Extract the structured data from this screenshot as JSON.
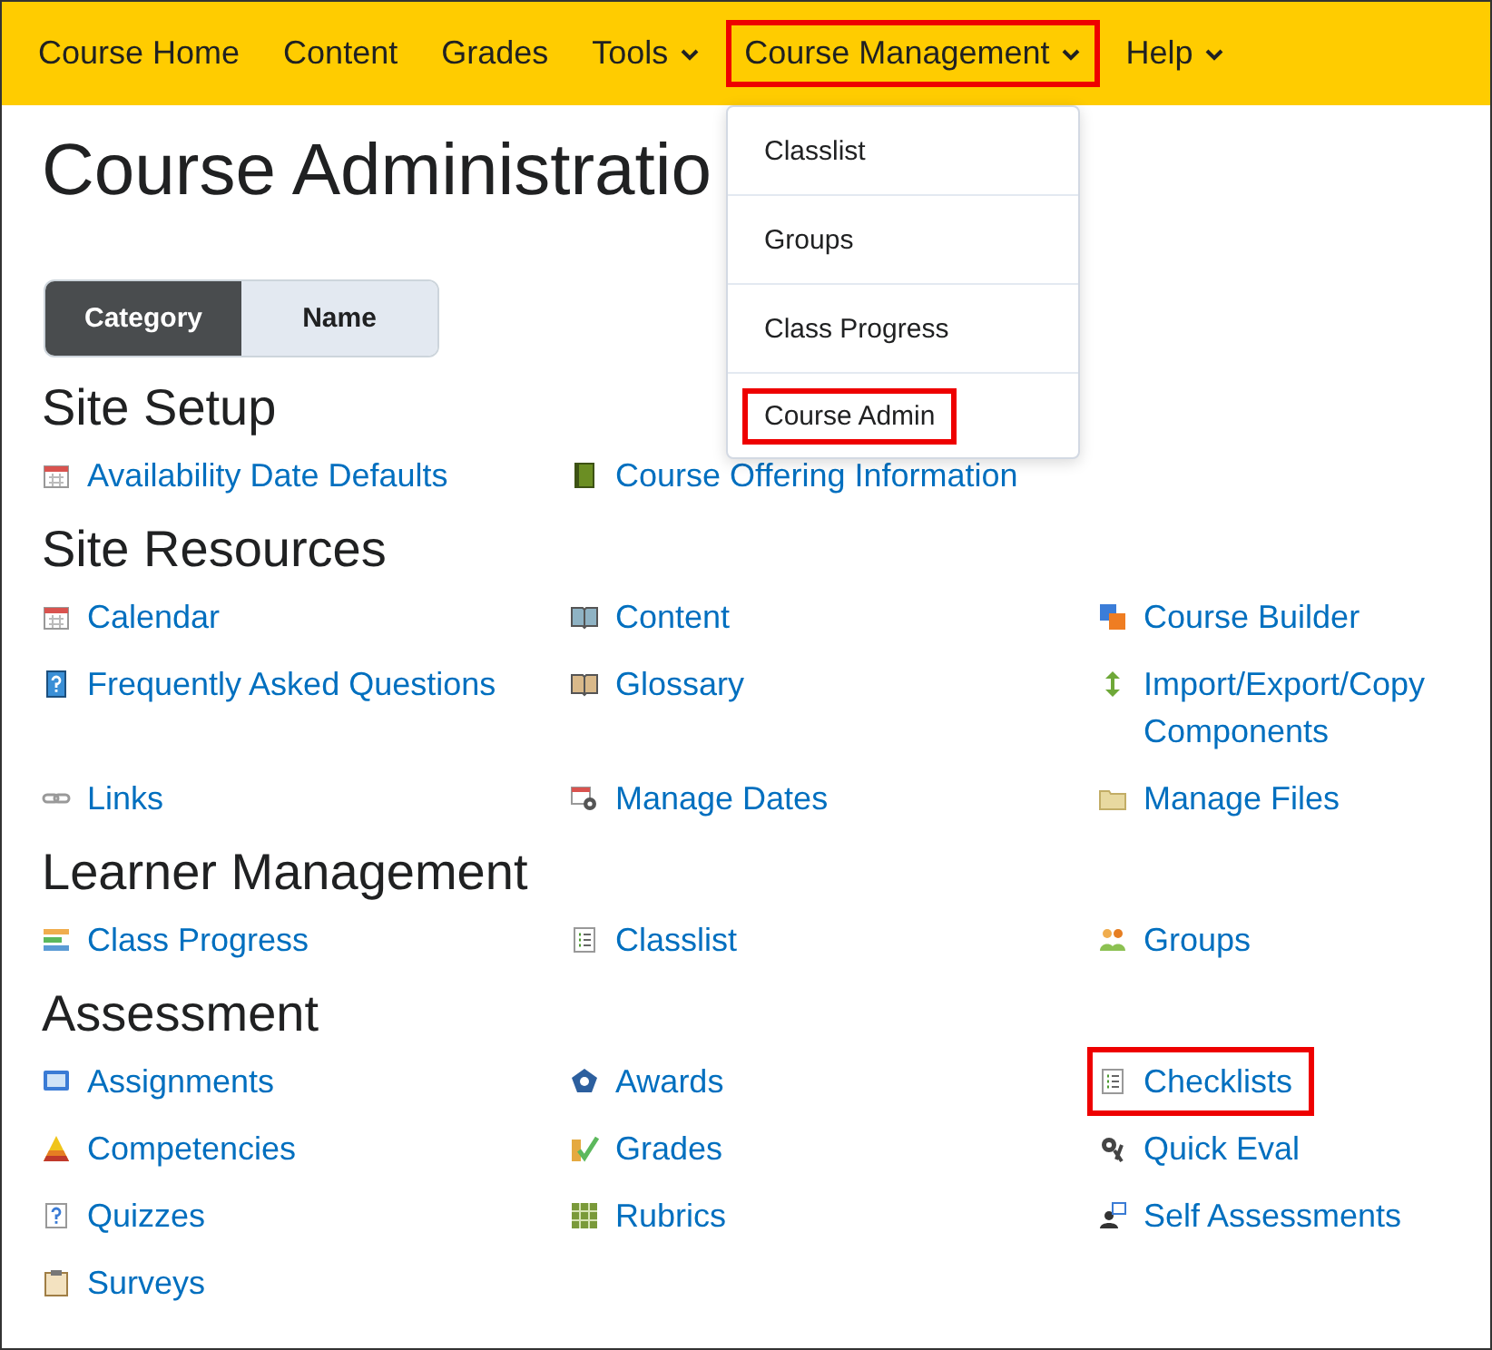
{
  "nav": {
    "items": [
      {
        "label": "Course Home",
        "menu": false,
        "highlighted": false
      },
      {
        "label": "Content",
        "menu": false,
        "highlighted": false
      },
      {
        "label": "Grades",
        "menu": false,
        "highlighted": false
      },
      {
        "label": "Tools",
        "menu": true,
        "highlighted": false
      },
      {
        "label": "Course Management",
        "menu": true,
        "highlighted": true
      },
      {
        "label": "Help",
        "menu": true,
        "highlighted": false
      }
    ]
  },
  "dropdown": {
    "items": [
      {
        "label": "Classlist",
        "highlighted": false
      },
      {
        "label": "Groups",
        "highlighted": false
      },
      {
        "label": "Class Progress",
        "highlighted": false
      },
      {
        "label": "Course Admin",
        "highlighted": true
      }
    ]
  },
  "title": "Course Administratio",
  "view_toggle": [
    {
      "label": "Category",
      "selected": true
    },
    {
      "label": "Name",
      "selected": false
    }
  ],
  "sections": [
    {
      "heading": "Site Setup",
      "links": [
        {
          "label": "Availability Date Defaults",
          "kind": "calendar",
          "highlighted": false
        },
        {
          "label": "Course Offering Information",
          "kind": "book",
          "highlighted": false
        }
      ]
    },
    {
      "heading": "Site Resources",
      "links": [
        {
          "label": "Calendar",
          "kind": "calendar",
          "highlighted": false
        },
        {
          "label": "Content",
          "kind": "openbook",
          "highlighted": false
        },
        {
          "label": "Course Builder",
          "kind": "blocks",
          "highlighted": false
        },
        {
          "label": "Frequently Asked Questions",
          "kind": "faq",
          "highlighted": false
        },
        {
          "label": "Glossary",
          "kind": "glossary",
          "highlighted": false
        },
        {
          "label": "Import/Export/Copy Components",
          "kind": "arrows",
          "highlighted": false
        },
        {
          "label": "Links",
          "kind": "link",
          "highlighted": false
        },
        {
          "label": "Manage Dates",
          "kind": "calgear",
          "highlighted": false
        },
        {
          "label": "Manage Files",
          "kind": "folder",
          "highlighted": false
        }
      ]
    },
    {
      "heading": "Learner Management",
      "links": [
        {
          "label": "Class Progress",
          "kind": "progress",
          "highlighted": false
        },
        {
          "label": "Classlist",
          "kind": "list",
          "highlighted": false
        },
        {
          "label": "Groups",
          "kind": "people",
          "highlighted": false
        }
      ]
    },
    {
      "heading": "Assessment",
      "links": [
        {
          "label": "Assignments",
          "kind": "monitor",
          "highlighted": false
        },
        {
          "label": "Awards",
          "kind": "badge",
          "highlighted": false
        },
        {
          "label": "Checklists",
          "kind": "list",
          "highlighted": true
        },
        {
          "label": "Competencies",
          "kind": "pyramid",
          "highlighted": false
        },
        {
          "label": "Grades",
          "kind": "check",
          "highlighted": false
        },
        {
          "label": "Quick Eval",
          "kind": "gear",
          "highlighted": false
        },
        {
          "label": "Quizzes",
          "kind": "quiz",
          "highlighted": false
        },
        {
          "label": "Rubrics",
          "kind": "grid",
          "highlighted": false
        },
        {
          "label": "Self Assessments",
          "kind": "person",
          "highlighted": false
        },
        {
          "label": "Surveys",
          "kind": "clipboard",
          "highlighted": false
        }
      ]
    }
  ]
}
